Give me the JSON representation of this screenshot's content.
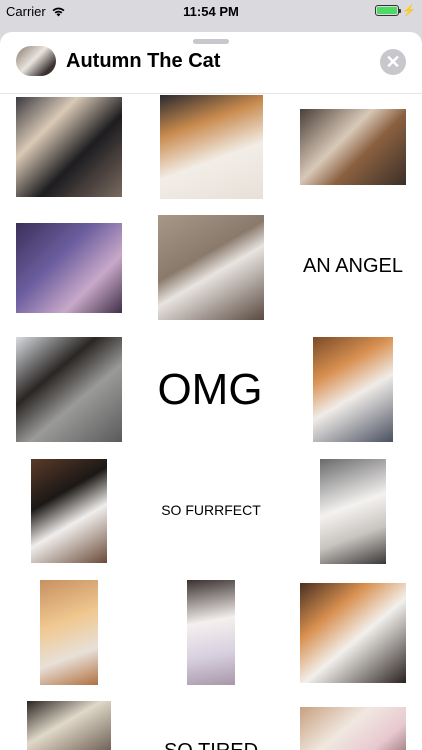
{
  "status": {
    "carrier": "Carrier",
    "time": "11:54 PM"
  },
  "header": {
    "title": "Autumn The Cat",
    "close_symbol": "✕"
  },
  "stickers": {
    "angel": "AN ANGEL",
    "omg": "OMG",
    "furrfect": "SO FURRFECT",
    "tired": "SO TIRED"
  },
  "icons": {
    "wifi": "wifi-icon",
    "battery": "battery-icon",
    "close": "close-icon"
  },
  "colors": {
    "battery_green": "#4cd964",
    "sheet_bg": "#ffffff",
    "close_bg": "#c7c7cc"
  }
}
